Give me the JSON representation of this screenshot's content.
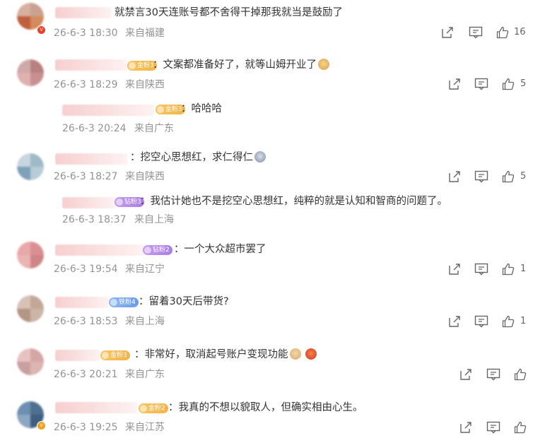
{
  "comments": [
    {
      "id": "c1",
      "text": "就禁言30天连账号都不舍得干掉那我就当是鼓励了",
      "date": "26-6-3 18:30",
      "location": "来自福建",
      "likes": "16"
    },
    {
      "id": "c2",
      "fan_badge": "金粉3",
      "text": "：文案都准备好了，就等山姆开业了",
      "emoji": "doge-emoji",
      "date": "26-6-3 18:29",
      "location": "来自陕西",
      "likes": "5",
      "reply": {
        "fan_badge": "金粉3",
        "text": "：哈哈哈",
        "date": "26-6-3 20:24",
        "location": "来自广东"
      }
    },
    {
      "id": "c3",
      "text": "：挖空心思想红，求仁得仁",
      "emoji": "crying-emoji",
      "date": "26-6-3 18:27",
      "location": "来自陕西",
      "likes": "5",
      "reply": {
        "fan_badge": "钻粉3",
        "text": "：我估计她也不是挖空心思想红，纯粹的就是认知和智商的问题了。",
        "date": "26-6-3 18:37",
        "location": "来自上海"
      }
    },
    {
      "id": "c4",
      "fan_badge": "钻粉2",
      "text": "：一个大众超市罢了",
      "date": "26-6-3 19:54",
      "location": "来自辽宁",
      "likes": "1"
    },
    {
      "id": "c5",
      "fan_badge": "铁粉4",
      "text": "：留着30天后带货?",
      "date": "26-6-3 18:53",
      "location": "来自上海",
      "likes": "1"
    },
    {
      "id": "c6",
      "fan_badge": "金粉3",
      "text": "：非常好，取消起号账户变现功能",
      "emoji": "clap-emoji",
      "emoji2": "angry-emoji",
      "date": "26-6-3 20:21",
      "location": "来自广东",
      "likes": ""
    },
    {
      "id": "c7",
      "fan_badge": "金粉2",
      "text": "：我真的不想以貌取人，但确实相由心生。",
      "date": "26-6-3 19:25",
      "location": "来自江苏",
      "likes": ""
    }
  ],
  "icons": {
    "share": "share-icon",
    "comment": "comment-icon",
    "like": "like-icon"
  },
  "colors": {
    "meta": "#939393",
    "text": "#333333",
    "gold_badge": "#f3b34a",
    "purple_badge": "#a97de6",
    "blue_badge": "#6c9ce8"
  }
}
